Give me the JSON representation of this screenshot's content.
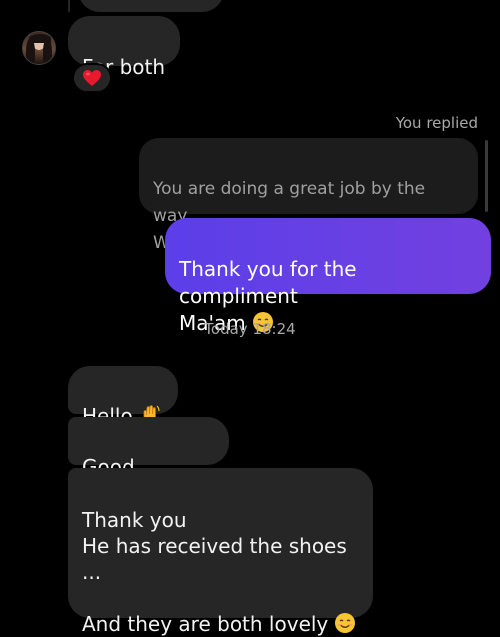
{
  "conversation": {
    "previous_message_stub": "",
    "incoming_1": {
      "text": "For both",
      "reaction_icon": "red-heart-icon"
    },
    "reply_label": "You replied",
    "quoted_message": "You are doing a great job by the way...\nWell done...more",
    "outgoing": {
      "text": "Thank you for the compliment\nMa'am",
      "emoji_icon": "smiling-face-icon"
    },
    "timestamp": "Today 18:24",
    "incoming_2": {
      "text": "Hello",
      "emoji_icon": "waving-hand-icon"
    },
    "incoming_3": {
      "text": "Good evening"
    },
    "incoming_4": {
      "text": "Thank you\nHe has received the shoes ...\n\nAnd they are both lovely",
      "emoji_icon": "smiling-face-icon"
    }
  },
  "colors": {
    "background": "#000000",
    "incoming_bubble": "#262626",
    "outgoing_bubble": "#6d3ee6",
    "quoted_bubble": "#1c1c1c",
    "muted_text": "#a8a8a8"
  }
}
